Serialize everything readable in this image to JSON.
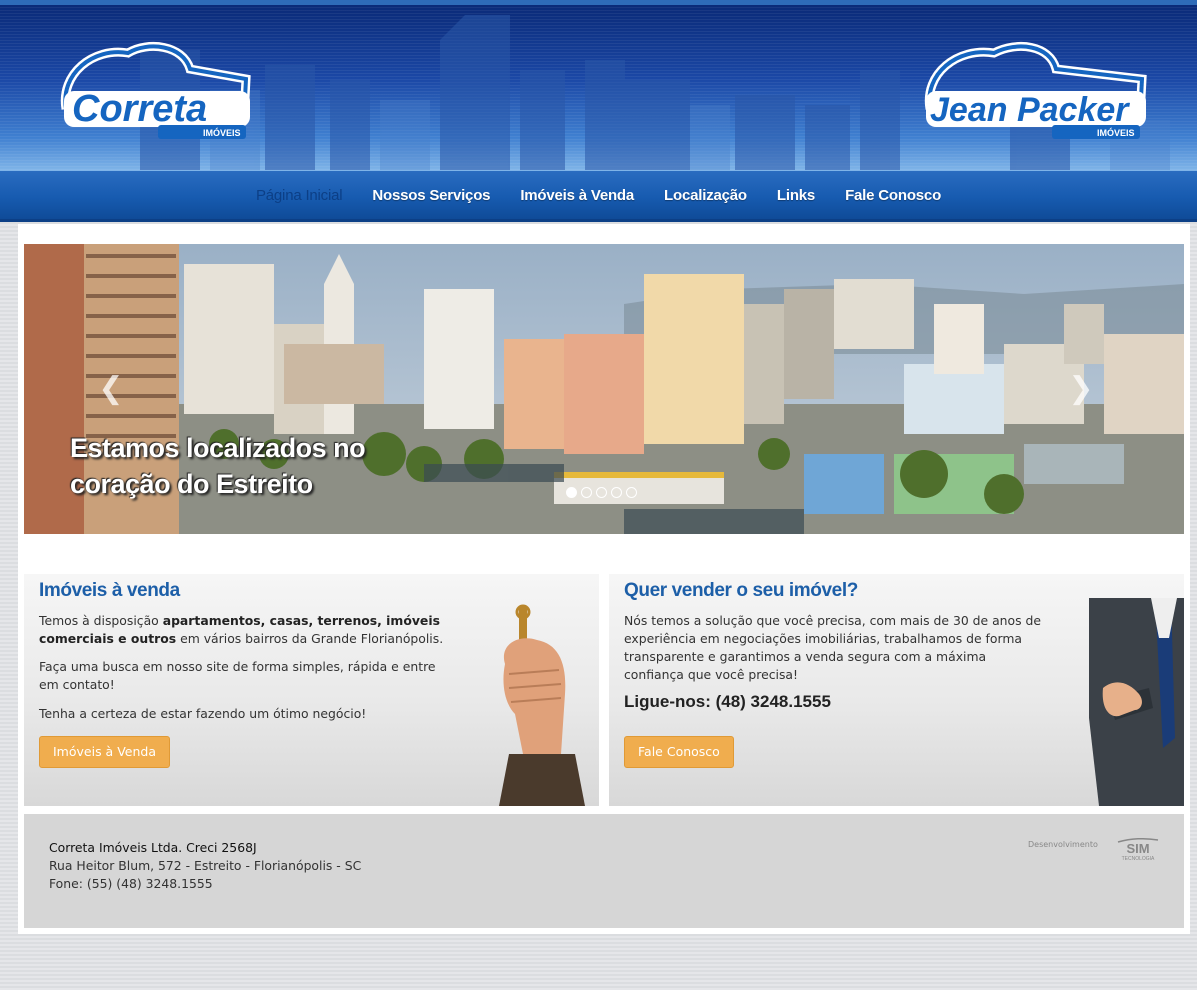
{
  "header": {
    "logo_left": {
      "main": "Correta",
      "sub": "IMÓVEIS"
    },
    "logo_right": {
      "main": "Jean Packer",
      "sub": "IMÓVEIS"
    }
  },
  "nav": {
    "items": [
      {
        "label": "Página Inicial",
        "active": true
      },
      {
        "label": "Nossos Serviços",
        "active": false
      },
      {
        "label": "Imóveis à Venda",
        "active": false
      },
      {
        "label": "Localização",
        "active": false
      },
      {
        "label": "Links",
        "active": false
      },
      {
        "label": "Fale Conosco",
        "active": false
      }
    ]
  },
  "slider": {
    "caption_line1": "Estamos localizados no",
    "caption_line2": "coração do Estreito",
    "prev_icon": "chevron-left-icon",
    "next_icon": "chevron-right-icon",
    "slide_count": 5,
    "active_slide": 1
  },
  "panel_left": {
    "title": "Imóveis à venda",
    "p1_pre": "Temos à disposição ",
    "p1_bold": "apartamentos, casas, terrenos, imóveis comerciais e outros",
    "p1_post": " em vários bairros da Grande Florianópolis.",
    "p2": "Faça uma busca em nosso site de forma simples, rápida e entre em contato!",
    "p3": "Tenha a certeza de estar fazendo um ótimo negócio!",
    "button": "Imóveis à Venda"
  },
  "panel_right": {
    "title": "Quer vender o seu imóvel?",
    "p1": "Nós temos a solução que você precisa, com mais de 30 de anos de experiência em negociações imobiliárias, trabalhamos de forma transparente e garantimos a venda segura com a máxima confiança que você precisa!",
    "phone": "Ligue-nos: (48) 3248.1555",
    "button": "Fale Conosco"
  },
  "footer": {
    "company": "Correta Imóveis Ltda. Creci 2568J",
    "address": "Rua Heitor Blum, 572 - Estreito - Florianópolis - SC",
    "phone": "Fone: (55) (48) 3248.1555",
    "dev_label": "Desenvolvimento",
    "dev_logo": "SIM",
    "dev_logo_sub": "TECNOLOGIA"
  },
  "colors": {
    "brand_blue": "#1d5fa8",
    "nav_blue": "#175bb0",
    "button_orange": "#f0ad4e"
  }
}
